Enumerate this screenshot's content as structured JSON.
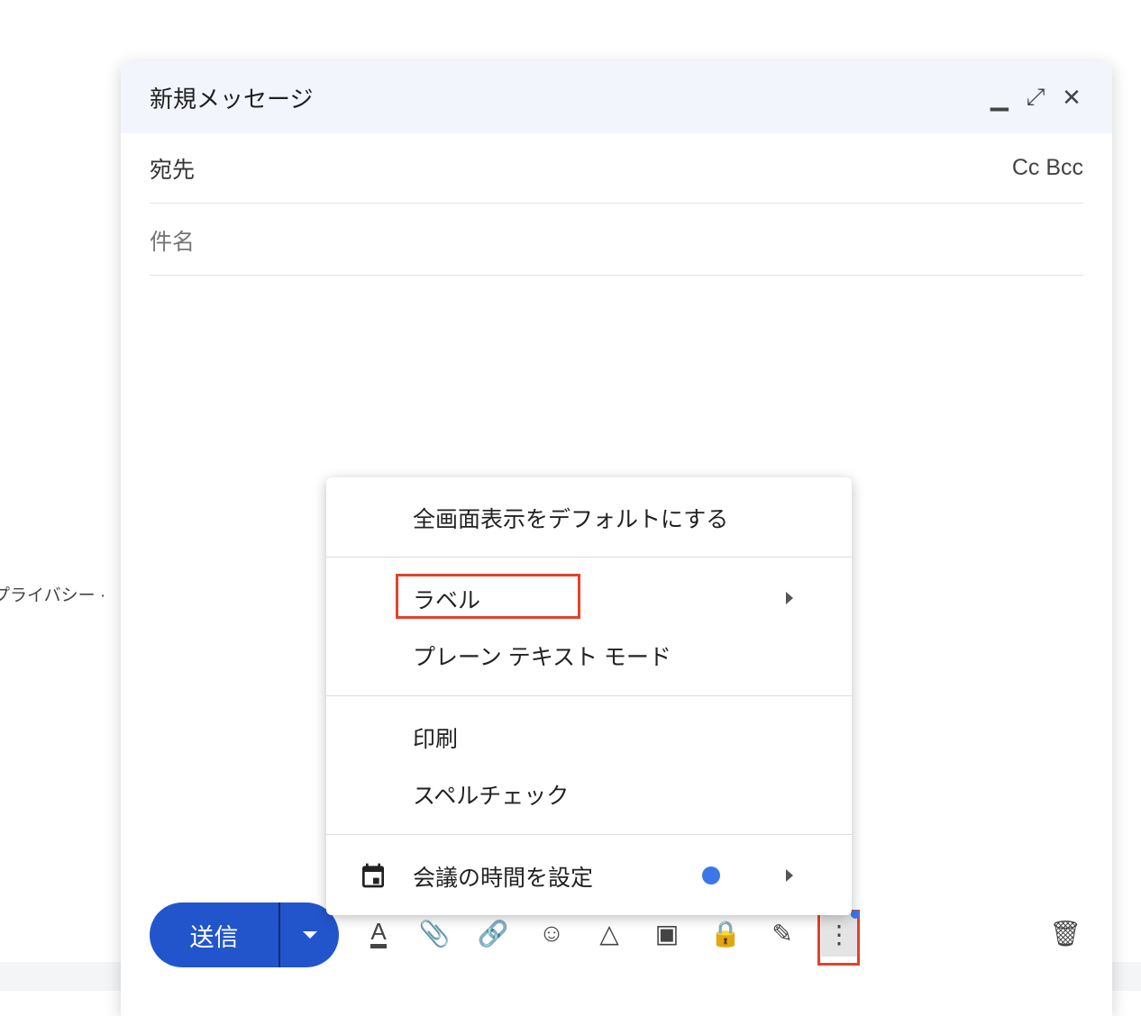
{
  "background": {
    "partial_text": "プライバシー ·"
  },
  "compose": {
    "title": "新規メッセージ",
    "to_label": "宛先",
    "cc_bcc": "Cc Bcc",
    "subject_placeholder": "件名",
    "send_label": "送信"
  },
  "menu": {
    "items": [
      {
        "label": "全画面表示をデフォルトにする"
      },
      {
        "label": "ラベル"
      },
      {
        "label": "プレーン テキスト モード"
      },
      {
        "label": "印刷"
      },
      {
        "label": "スペルチェック"
      },
      {
        "label": "会議の時間を設定"
      }
    ]
  },
  "colors": {
    "accent": "#2255cc",
    "highlight": "#e3422c",
    "dot": "#3b78e7"
  }
}
